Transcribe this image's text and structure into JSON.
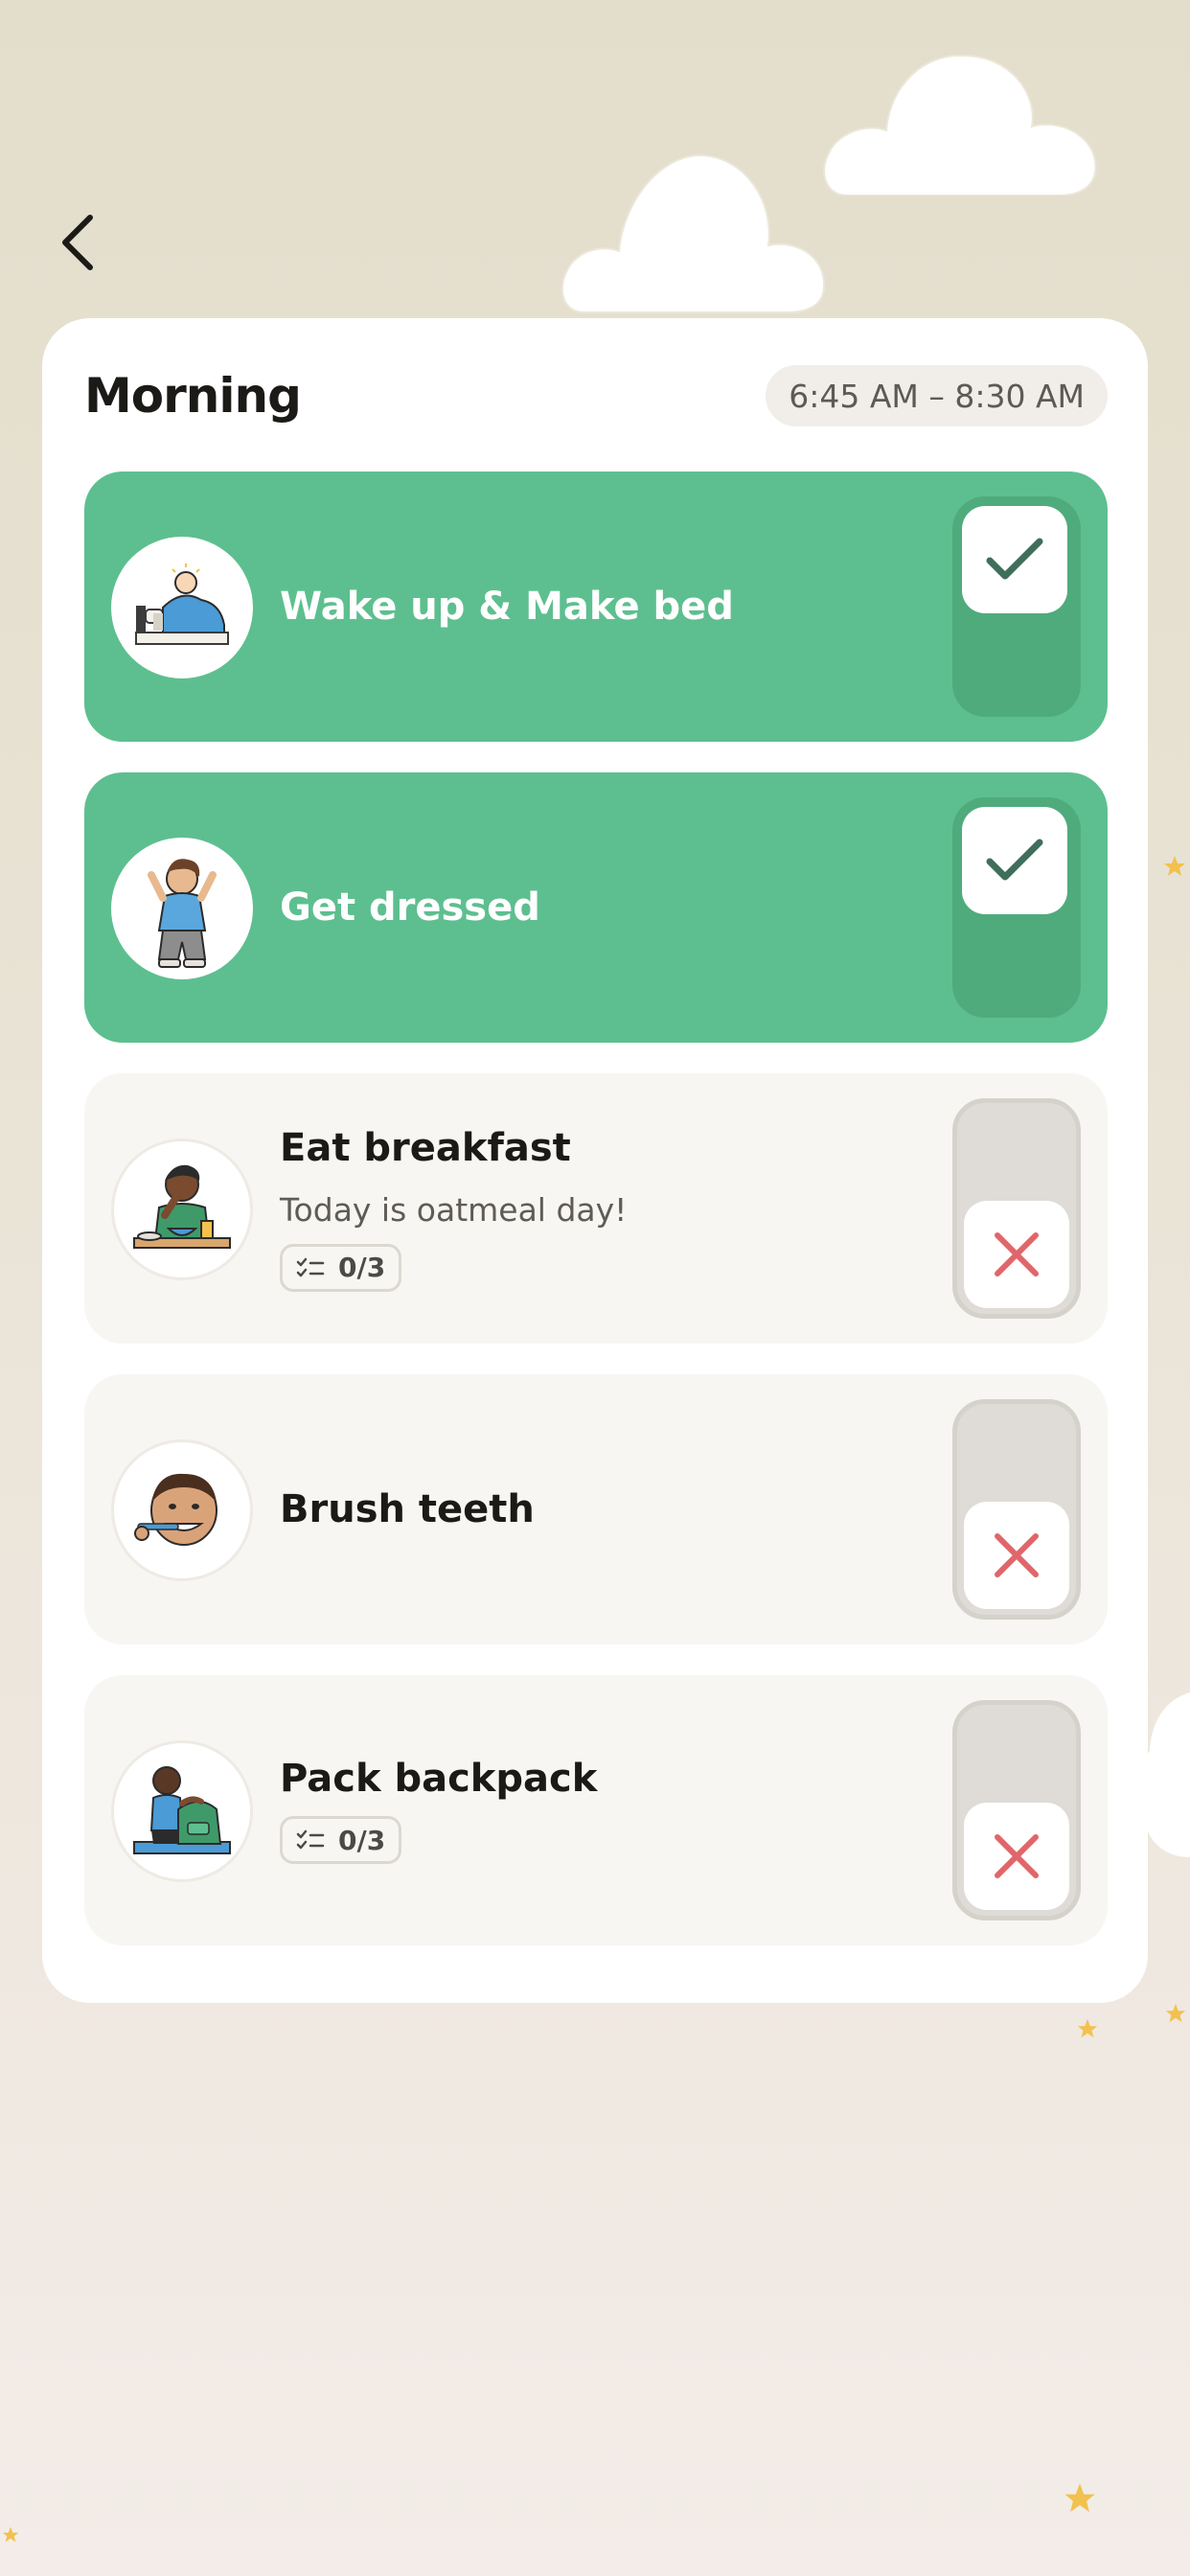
{
  "header": {
    "back_label": "Back"
  },
  "routine": {
    "title": "Morning",
    "time_range": "6:45 AM – 8:30 AM"
  },
  "tasks": [
    {
      "name": "Wake up & Make bed",
      "completed": true,
      "icon": "kid-making-bed-icon"
    },
    {
      "name": "Get dressed",
      "completed": true,
      "icon": "kid-getting-dressed-icon"
    },
    {
      "name": "Eat breakfast",
      "subtitle": "Today is oatmeal day!",
      "checklist": "0/3",
      "completed": false,
      "icon": "kid-eating-breakfast-icon"
    },
    {
      "name": "Brush teeth",
      "completed": false,
      "icon": "kid-brushing-teeth-icon"
    },
    {
      "name": "Pack backpack",
      "checklist": "0/3",
      "completed": false,
      "icon": "kid-packing-backpack-icon"
    }
  ],
  "colors": {
    "done_bg": "#5dbf8f",
    "done_toggle": "#4fab7c",
    "check": "#3f6f5b",
    "cross": "#e0666a",
    "star": "#f2c14e"
  }
}
